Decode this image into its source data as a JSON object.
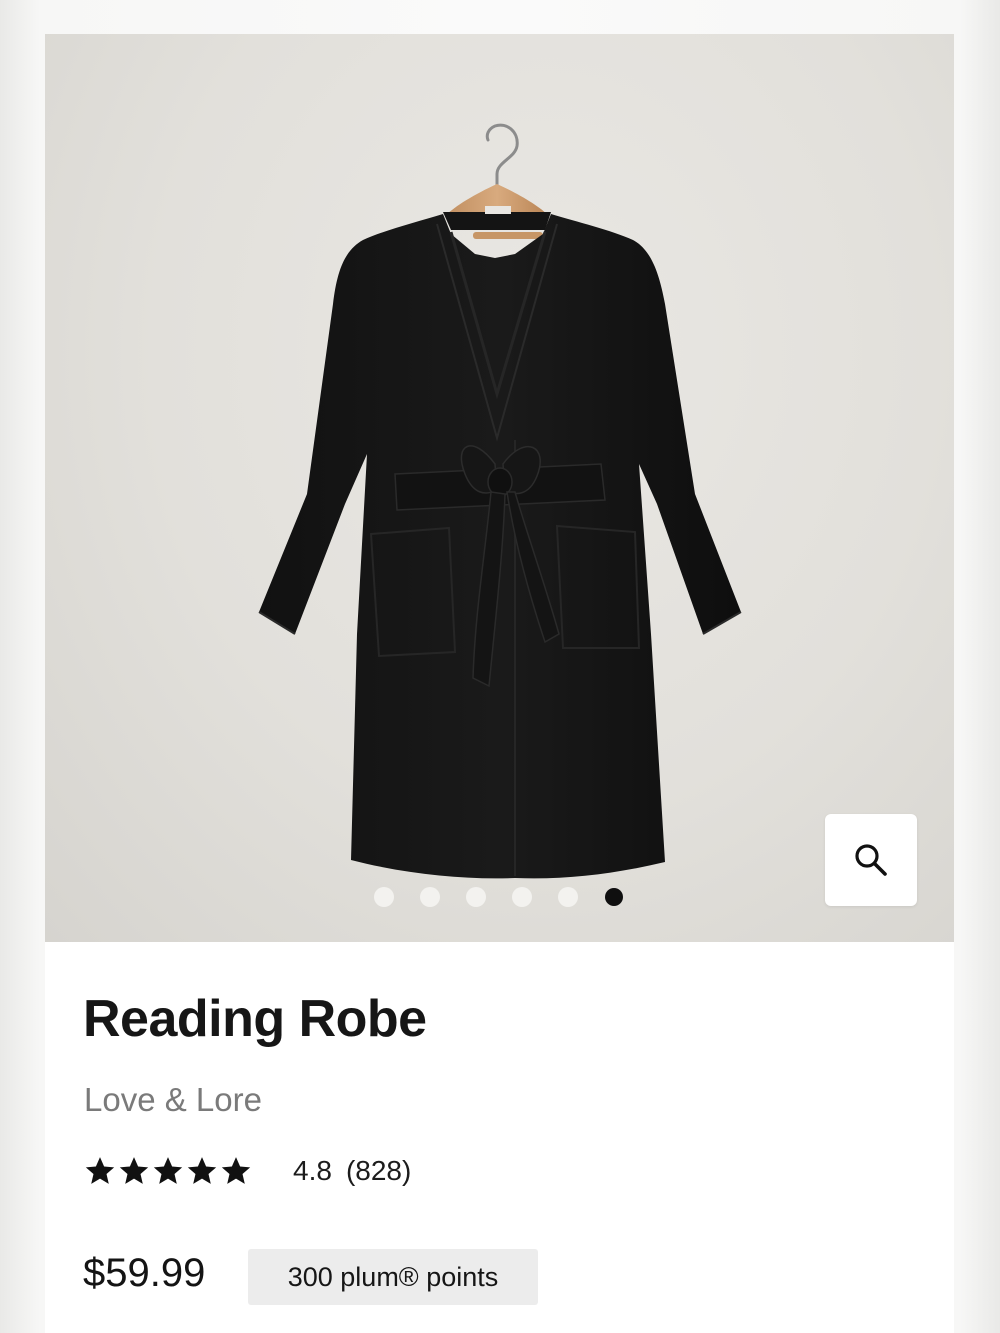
{
  "product": {
    "title": "Reading Robe",
    "brand": "Love & Lore",
    "rating_value": "4.8",
    "rating_count": "(828)",
    "star_rating": 5,
    "price": "$59.99",
    "points": "300 plum® points"
  },
  "gallery": {
    "image_count": 6,
    "active_index": 6,
    "zoom_icon": "search-icon"
  }
}
